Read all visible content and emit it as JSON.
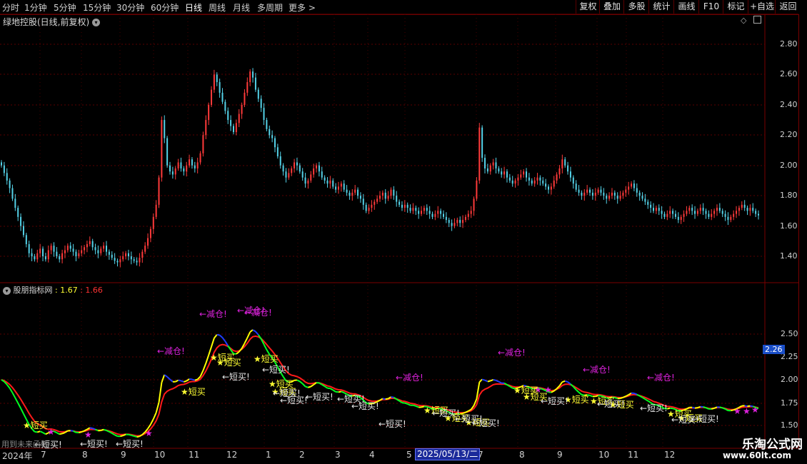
{
  "toolbar": {
    "periods": [
      "分时",
      "1分钟",
      "5分钟",
      "15分钟",
      "30分钟",
      "60分钟",
      "日线",
      "周线",
      "月线",
      "多周期",
      "更多"
    ],
    "active_period": "日线",
    "buttons": [
      "复权",
      "叠加",
      "多股",
      "统计",
      "画线",
      "F10",
      "标记",
      "+自选",
      "返回"
    ]
  },
  "main_chart": {
    "title": "绿地控股(日线,前复权)",
    "price_labels": [
      "2.80",
      "2.60",
      "2.40",
      "2.20",
      "2.00",
      "1.80",
      "1.60",
      "1.40"
    ]
  },
  "indicator": {
    "name": "股朋指标网",
    "value1": ": 1.67",
    "value2": ": 1.66",
    "axis_labels": [
      "2.50",
      "2.25",
      "2.00",
      "1.75",
      "1.50"
    ],
    "current_value": "2.26",
    "future_note": "用到未来函数",
    "annotations": {
      "reduce": "←减仓!",
      "buy_star": "★短买",
      "buy_arrow": "←短买!"
    }
  },
  "x_axis": {
    "labels": [
      "2024年",
      "7",
      "8",
      "9",
      "10",
      "11",
      "12",
      "1",
      "2",
      "3",
      "4",
      "5",
      "7",
      "8",
      "9",
      "10",
      "11",
      "12"
    ],
    "selected_date": "2025/05/13/二"
  },
  "watermark": {
    "brand": "乐淘公式网",
    "url": "www.60lt.com"
  },
  "colors": {
    "up_candle": "#ff3a3a",
    "down_candle": "#54d2e8",
    "grid": "#7a0000",
    "yellow_line": "#ffff00",
    "red_line": "#ff1a1a",
    "green_line": "#00ff22",
    "blue_line": "#1f3cff",
    "magenta": "#dd22dd"
  },
  "chart_data": {
    "type": "candlestick",
    "close": [
      2.0,
      1.95,
      1.9,
      1.85,
      1.78,
      1.72,
      1.66,
      1.6,
      1.54,
      1.48,
      1.42,
      1.4,
      1.38,
      1.42,
      1.45,
      1.4,
      1.38,
      1.44,
      1.47,
      1.43,
      1.4,
      1.38,
      1.42,
      1.44,
      1.47,
      1.45,
      1.43,
      1.4,
      1.42,
      1.44,
      1.46,
      1.48,
      1.5,
      1.46,
      1.44,
      1.42,
      1.45,
      1.47,
      1.43,
      1.41,
      1.39,
      1.37,
      1.36,
      1.38,
      1.4,
      1.42,
      1.4,
      1.38,
      1.37,
      1.36,
      1.39,
      1.43,
      1.47,
      1.52,
      1.58,
      1.66,
      1.74,
      1.92,
      2.3,
      2.18,
      2.0,
      1.96,
      1.94,
      1.98,
      2.02,
      1.98,
      1.96,
      2.0,
      2.04,
      2.0,
      1.98,
      2.02,
      2.08,
      2.2,
      2.3,
      2.4,
      2.5,
      2.6,
      2.55,
      2.48,
      2.42,
      2.36,
      2.3,
      2.26,
      2.22,
      2.28,
      2.34,
      2.4,
      2.48,
      2.55,
      2.62,
      2.58,
      2.5,
      2.44,
      2.38,
      2.3,
      2.24,
      2.2,
      2.18,
      2.12,
      2.06,
      2.0,
      1.96,
      1.92,
      1.95,
      1.98,
      2.02,
      2.0,
      1.96,
      1.92,
      1.88,
      1.9,
      1.94,
      1.98,
      2.0,
      1.96,
      1.92,
      1.9,
      1.88,
      1.9,
      1.86,
      1.84,
      1.86,
      1.88,
      1.84,
      1.82,
      1.8,
      1.82,
      1.84,
      1.8,
      1.78,
      1.74,
      1.7,
      1.72,
      1.74,
      1.76,
      1.78,
      1.8,
      1.82,
      1.78,
      1.8,
      1.84,
      1.8,
      1.76,
      1.74,
      1.72,
      1.74,
      1.72,
      1.7,
      1.72,
      1.7,
      1.68,
      1.7,
      1.72,
      1.7,
      1.68,
      1.66,
      1.68,
      1.7,
      1.68,
      1.66,
      1.64,
      1.62,
      1.6,
      1.62,
      1.64,
      1.62,
      1.64,
      1.66,
      1.68,
      1.7,
      1.78,
      1.9,
      2.25,
      2.05,
      1.98,
      1.96,
      2.0,
      2.02,
      1.98,
      1.96,
      1.94,
      1.96,
      1.92,
      1.9,
      1.88,
      1.9,
      1.92,
      1.94,
      1.96,
      1.92,
      1.9,
      1.88,
      1.9,
      1.92,
      1.9,
      1.88,
      1.86,
      1.84,
      1.86,
      1.9,
      1.94,
      1.98,
      2.04,
      2.0,
      1.96,
      1.92,
      1.88,
      1.84,
      1.82,
      1.8,
      1.82,
      1.84,
      1.82,
      1.8,
      1.82,
      1.84,
      1.82,
      1.8,
      1.78,
      1.8,
      1.82,
      1.8,
      1.78,
      1.8,
      1.82,
      1.84,
      1.86,
      1.88,
      1.85,
      1.82,
      1.8,
      1.78,
      1.76,
      1.74,
      1.72,
      1.7,
      1.72,
      1.7,
      1.68,
      1.66,
      1.68,
      1.7,
      1.68,
      1.66,
      1.64,
      1.66,
      1.68,
      1.7,
      1.72,
      1.7,
      1.68,
      1.7,
      1.72,
      1.7,
      1.68,
      1.66,
      1.68,
      1.7,
      1.72,
      1.7,
      1.68,
      1.66,
      1.64,
      1.66,
      1.68,
      1.7,
      1.72,
      1.74,
      1.72,
      1.7,
      1.72,
      1.7,
      1.68,
      1.67
    ]
  }
}
